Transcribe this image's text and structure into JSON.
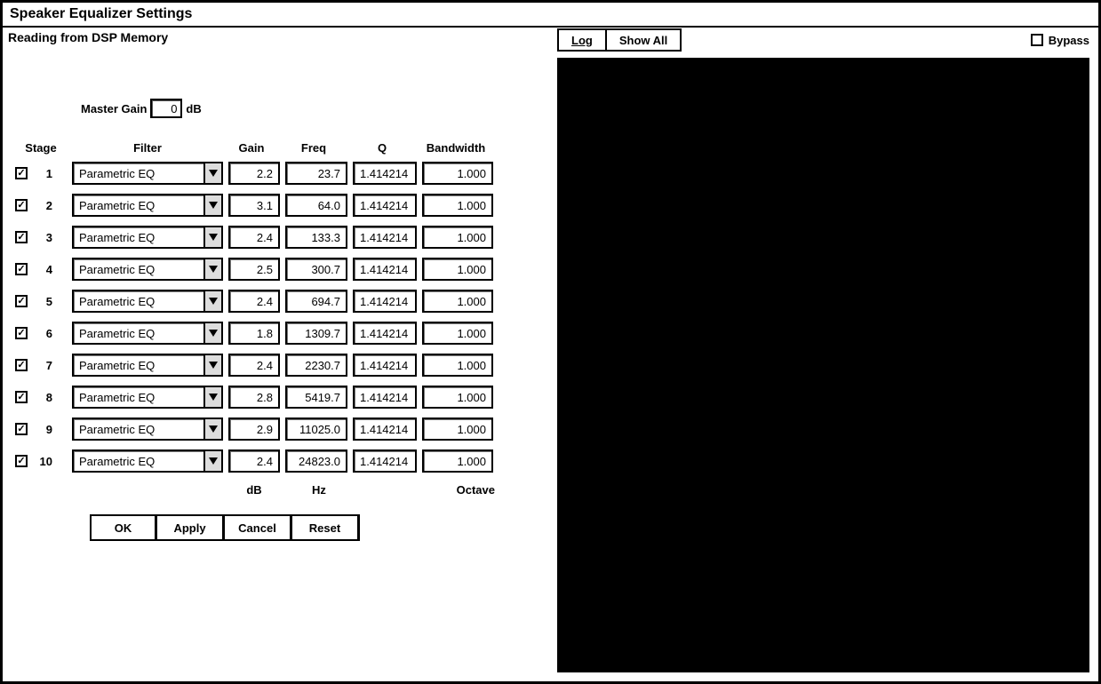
{
  "window": {
    "title": "Speaker Equalizer Settings"
  },
  "status_text": "Reading from DSP Memory",
  "master_gain": {
    "label": "Master Gain",
    "value": "0",
    "unit": "dB"
  },
  "columns": {
    "stage": "Stage",
    "filter": "Filter",
    "gain": "Gain",
    "freq": "Freq",
    "q": "Q",
    "bandwidth": "Bandwidth"
  },
  "units": {
    "gain": "dB",
    "freq": "Hz",
    "bandwidth": "Octave"
  },
  "filter_option": "Parametric EQ",
  "stages": [
    {
      "n": "1",
      "gain": "2.2",
      "freq": "23.7",
      "q": "1.414214",
      "bw": "1.000"
    },
    {
      "n": "2",
      "gain": "3.1",
      "freq": "64.0",
      "q": "1.414214",
      "bw": "1.000"
    },
    {
      "n": "3",
      "gain": "2.4",
      "freq": "133.3",
      "q": "1.414214",
      "bw": "1.000"
    },
    {
      "n": "4",
      "gain": "2.5",
      "freq": "300.7",
      "q": "1.414214",
      "bw": "1.000"
    },
    {
      "n": "5",
      "gain": "2.4",
      "freq": "694.7",
      "q": "1.414214",
      "bw": "1.000"
    },
    {
      "n": "6",
      "gain": "1.8",
      "freq": "1309.7",
      "q": "1.414214",
      "bw": "1.000"
    },
    {
      "n": "7",
      "gain": "2.4",
      "freq": "2230.7",
      "q": "1.414214",
      "bw": "1.000"
    },
    {
      "n": "8",
      "gain": "2.8",
      "freq": "5419.7",
      "q": "1.414214",
      "bw": "1.000"
    },
    {
      "n": "9",
      "gain": "2.9",
      "freq": "11025.0",
      "q": "1.414214",
      "bw": "1.000"
    },
    {
      "n": "10",
      "gain": "2.4",
      "freq": "24823.0",
      "q": "1.414214",
      "bw": "1.000"
    }
  ],
  "buttons": {
    "ok": "OK",
    "apply": "Apply",
    "cancel": "Cancel",
    "reset": "Reset"
  },
  "right": {
    "log_tab": "Log",
    "show_all_tab": "Show All",
    "bypass_label": "Bypass"
  }
}
